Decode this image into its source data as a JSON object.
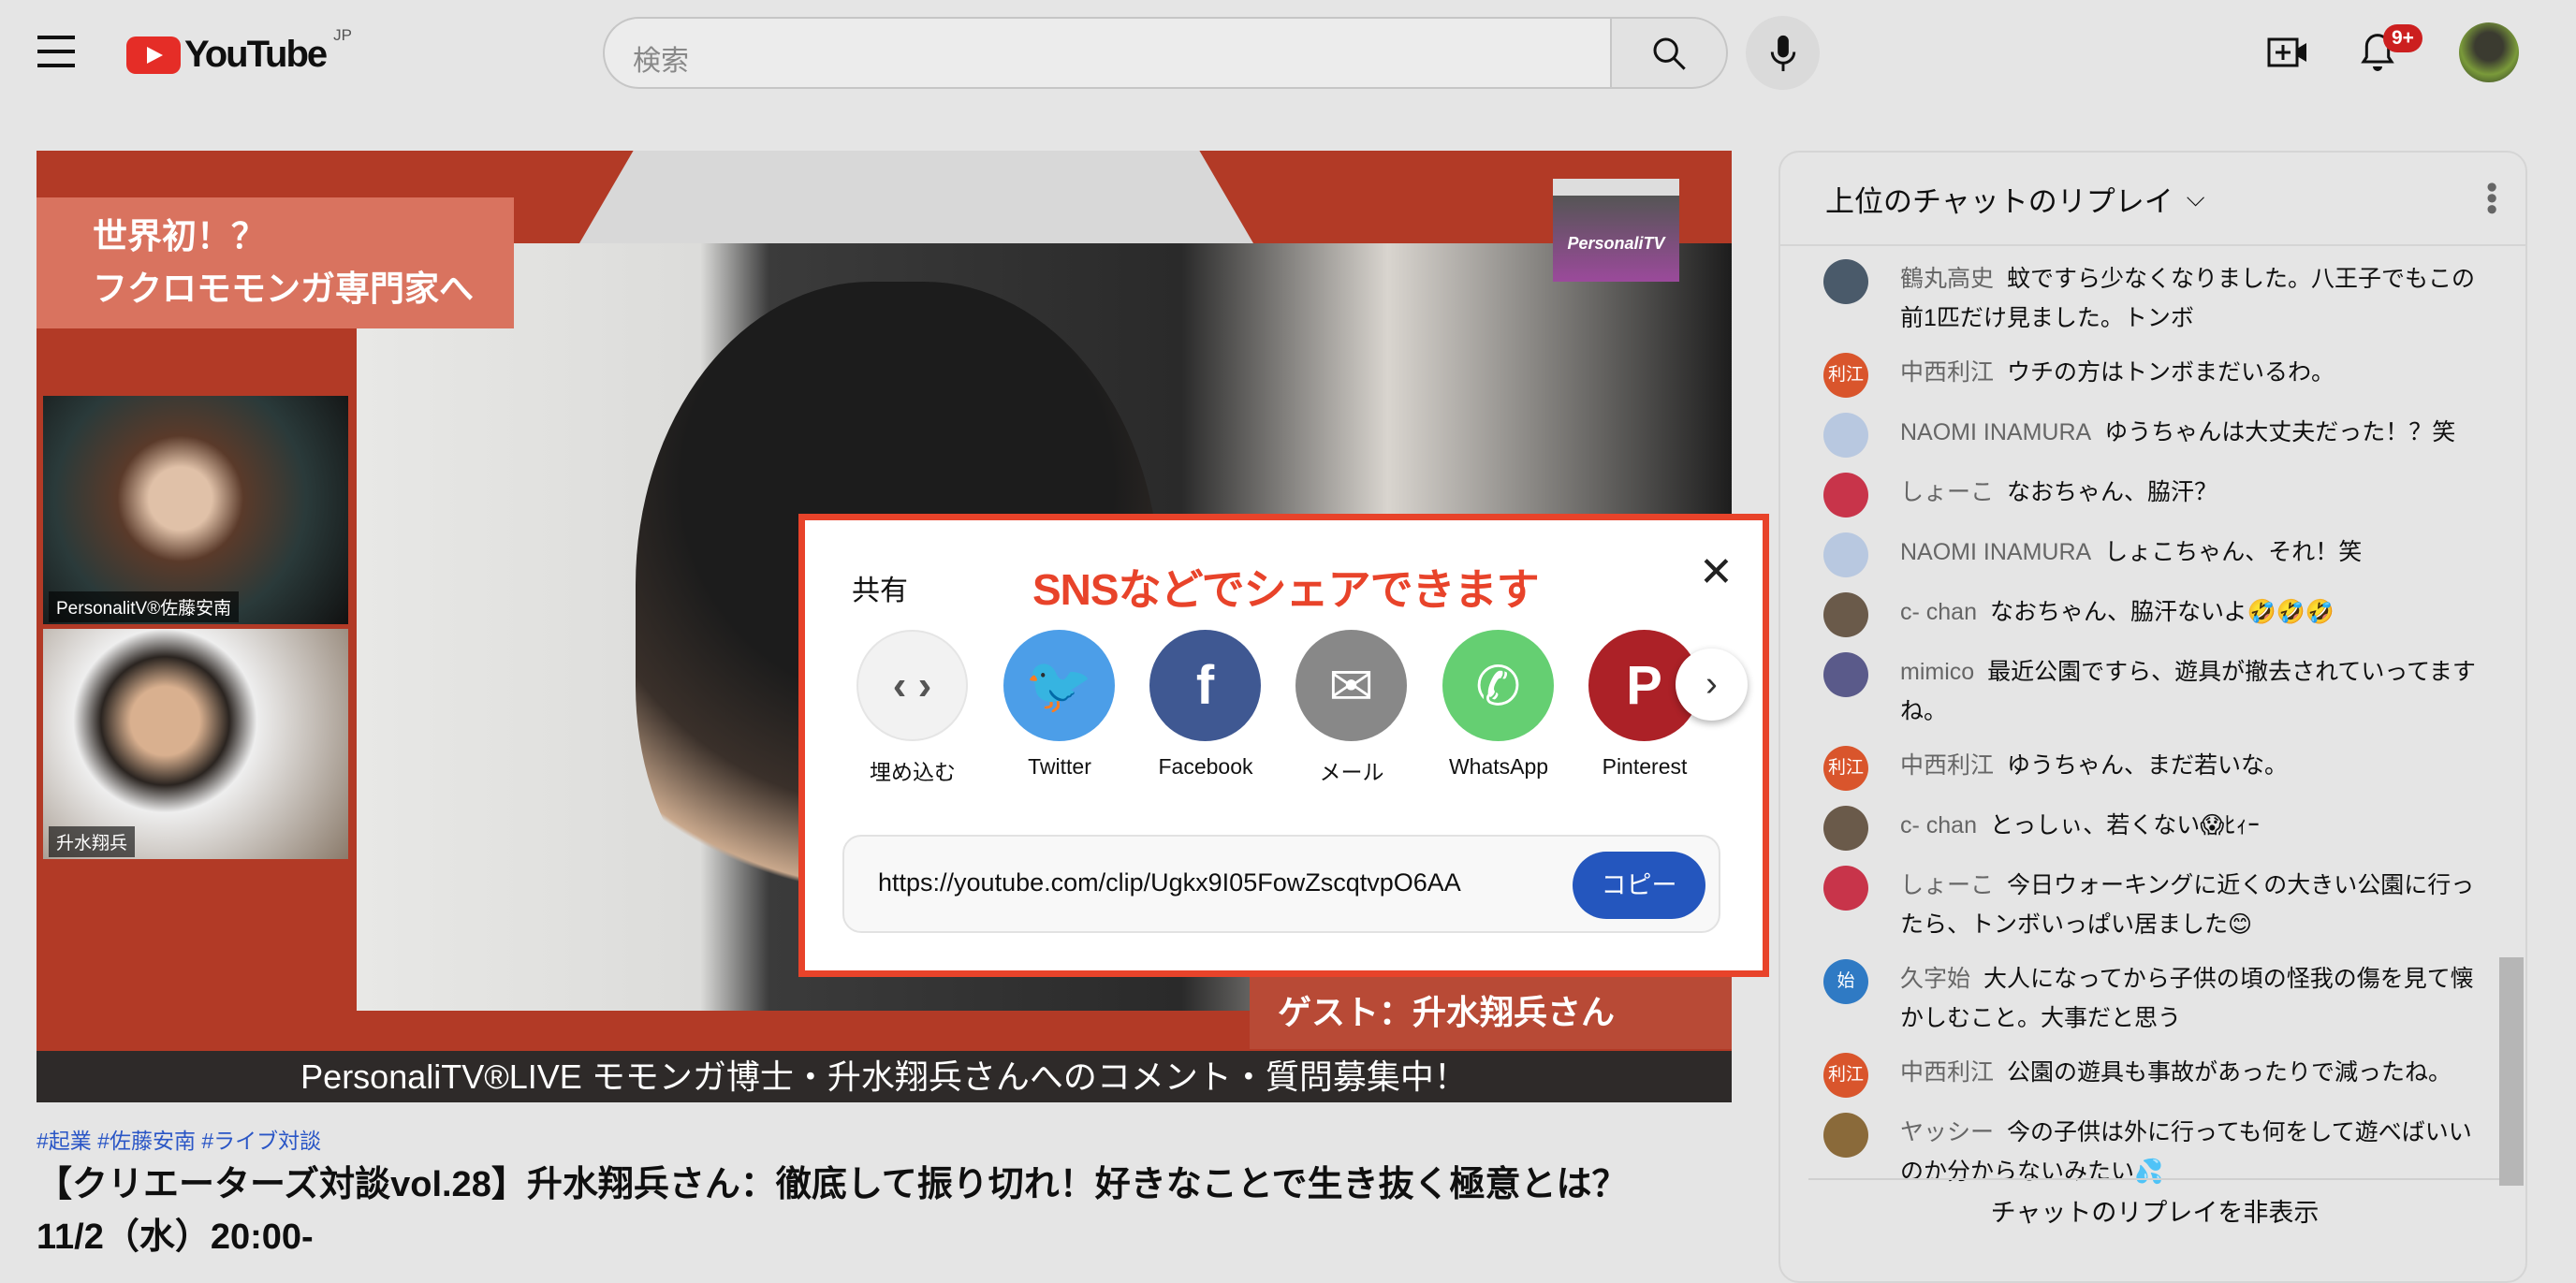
{
  "header": {
    "logo_text": "YouTube",
    "region": "JP",
    "search_placeholder": "検索",
    "notification_count": "9+"
  },
  "video": {
    "overlay_title_line1": "世界初！？",
    "overlay_title_line2": "フクロモモンガ専門家へ",
    "cam1_label": "PersonalitV®佐藤安南",
    "cam2_label": "升水翔兵",
    "channel_logo": "PersonaliTV",
    "guest_text": "ゲスト：升水翔兵さん",
    "ticker": "PersonaliTV®LIVE モモンガ博士・升水翔兵さんへのコメント・質問募集中！"
  },
  "hashtags": "#起業 #佐藤安南 #ライブ対談",
  "title_line1": "【クリエーターズ対談vol.28】升水翔兵さん：徹底して振り切れ！好きなことで生き抜く極意とは？",
  "title_line2": "11/2（水）20:00-",
  "chat": {
    "header": "上位のチャットのリプレイ",
    "footer": "チャットのリプレイを非表示",
    "messages": [
      {
        "author": "鶴丸高史",
        "text": "蚊ですら少なくなりました。八王子でもこの前1匹だけ見ました。トンボ",
        "avatar": "",
        "color": "#4a5a6a"
      },
      {
        "author": "中西利江",
        "text": "ウチの方はトンボまだいるわ。",
        "avatar": "利江",
        "color": "#d9552c"
      },
      {
        "author": "NAOMI INAMURA",
        "text": "ゆうちゃんは大丈夫だった！？笑",
        "avatar": "",
        "color": "#b8c8e0"
      },
      {
        "author": "しょーこ",
        "text": "なおちゃん、脇汗？",
        "avatar": "",
        "color": "#c8344a"
      },
      {
        "author": "NAOMI INAMURA",
        "text": "しょこちゃん、それ！笑",
        "avatar": "",
        "color": "#b8c8e0"
      },
      {
        "author": "c- chan",
        "text": "なおちゃん、脇汗ないよ🤣🤣🤣",
        "avatar": "",
        "color": "#6a5a4a"
      },
      {
        "author": "mimico",
        "text": "最近公園ですら、遊具が撤去されていってますね。",
        "avatar": "",
        "color": "#5a5a8a"
      },
      {
        "author": "中西利江",
        "text": "ゆうちゃん、まだ若いな。",
        "avatar": "利江",
        "color": "#d9552c"
      },
      {
        "author": "c- chan",
        "text": "とっしぃ、若くない😱ﾋｨｰ",
        "avatar": "",
        "color": "#6a5a4a"
      },
      {
        "author": "しょーこ",
        "text": "今日ウォーキングに近くの大きい公園に行ったら、トンボいっぱい居ました😊",
        "avatar": "",
        "color": "#c8344a"
      },
      {
        "author": "久字始",
        "text": "大人になってから子供の頃の怪我の傷を見て懐かしむこと。大事だと思う",
        "avatar": "始",
        "color": "#2f7ac4"
      },
      {
        "author": "中西利江",
        "text": "公園の遊具も事故があったりで減ったね。",
        "avatar": "利江",
        "color": "#d9552c"
      },
      {
        "author": "ヤッシー",
        "text": "今の子供は外に行っても何をして遊べばいいのか分からないみたい💦",
        "avatar": "",
        "color": "#8a6a3a"
      }
    ]
  },
  "share": {
    "title": "共有",
    "annotation": "SNSなどでシェアできます",
    "targets": [
      {
        "label": "埋め込む",
        "icon": "embed-icon",
        "color": "#f2f2f2",
        "glyph": "‹ ›"
      },
      {
        "label": "Twitter",
        "icon": "twitter-icon",
        "color": "#4c9ee8",
        "glyph": "🐦"
      },
      {
        "label": "Facebook",
        "icon": "facebook-icon",
        "color": "#3f5892",
        "glyph": "f"
      },
      {
        "label": "メール",
        "icon": "mail-icon",
        "color": "#888888",
        "glyph": "✉"
      },
      {
        "label": "WhatsApp",
        "icon": "whatsapp-icon",
        "color": "#65cf72",
        "glyph": "✆"
      },
      {
        "label": "Pinterest",
        "icon": "pinterest-icon",
        "color": "#ac2127",
        "glyph": "P"
      }
    ],
    "url": "https://youtube.com/clip/Ugkx9I05FowZscqtvpO6AA",
    "copy_label": "コピー"
  }
}
